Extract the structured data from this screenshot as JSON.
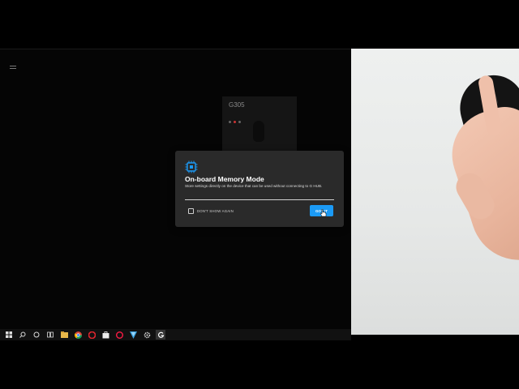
{
  "device": {
    "name": "G305"
  },
  "modal": {
    "title": "On-board Memory Mode",
    "description": "Store settings directly on the device that can be used without connecting to G HUB.",
    "checkbox_label": "DON'T SHOW AGAIN",
    "button_label": "GOT IT"
  },
  "taskbar": {
    "items": [
      "windows-start-icon",
      "search-icon",
      "cortana-icon",
      "task-view-icon",
      "file-explorer-icon",
      "chrome-icon",
      "opera-icon",
      "store-icon",
      "opera-gx-icon",
      "snip-icon",
      "settings-icon",
      "ghub-icon"
    ]
  },
  "colors": {
    "accent": "#1b9af5",
    "modal_bg": "#2a2a2a"
  }
}
